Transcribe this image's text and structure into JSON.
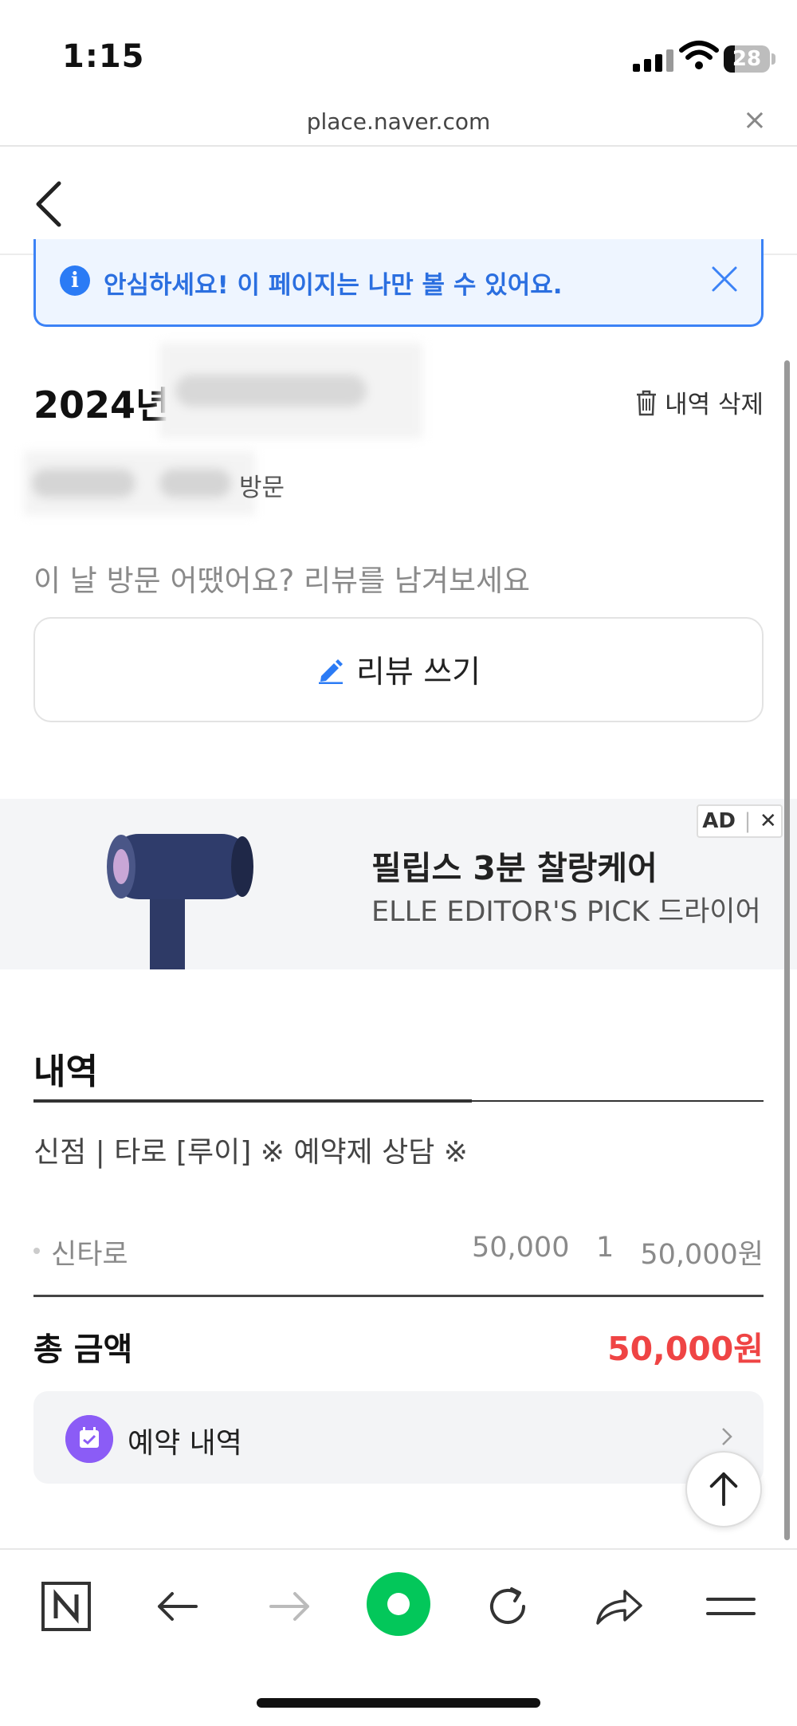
{
  "status_bar": {
    "time": "1:15",
    "battery": "28"
  },
  "url_bar": {
    "url": "place.naver.com",
    "close": "×"
  },
  "notice": {
    "text": "안심하세요! 이 페이지는 나만 볼 수 있어요."
  },
  "visit": {
    "title_prefix": "2024년",
    "visit_suffix": "방문",
    "delete_label": "내역 삭제",
    "prompt": "이 날 방문 어땠어요? 리뷰를 남겨보세요",
    "review_button": "리뷰 쓰기"
  },
  "ad": {
    "badge": "AD",
    "close": "✕",
    "title": "필립스 3분 찰랑케어",
    "subtitle": "ELLE EDITOR'S PICK 드라이어"
  },
  "details": {
    "section_title": "내역",
    "item_name": "신점 | 타로 [루이] ※ 예약제 상담 ※",
    "line_items": [
      {
        "name": "신타로",
        "price": "50,000",
        "qty": "1",
        "total": "50,000원"
      }
    ],
    "total_label": "총 금액",
    "total_value": "50,000원"
  },
  "reservation": {
    "label": "예약 내역"
  },
  "colors": {
    "accent": "#2b7bf5",
    "price_red": "#ef4444",
    "purple": "#8b5cf6",
    "naver_green": "#03c75a"
  },
  "icons": [
    "back-icon",
    "info-icon",
    "close-icon",
    "trash-icon",
    "pencil-icon",
    "calendar-icon",
    "chevron-right-icon",
    "arrow-up-icon",
    "naver-icon",
    "arrow-left-icon",
    "arrow-right-icon",
    "green-dot-icon",
    "reload-icon",
    "share-icon",
    "menu-icon"
  ]
}
